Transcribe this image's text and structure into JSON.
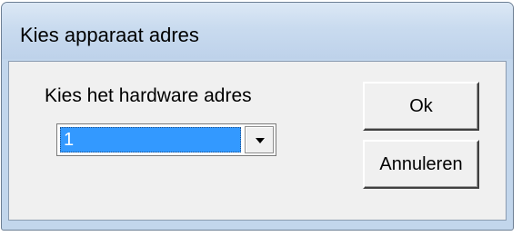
{
  "window": {
    "title": "Kies apparaat adres"
  },
  "dialog": {
    "prompt_label": "Kies het hardware adres",
    "address_select": {
      "selected_value": "1"
    },
    "ok_label": "Ok",
    "cancel_label": "Annuleren"
  },
  "icons": {
    "dropdown": "chevron-down-icon"
  },
  "colors": {
    "selection_highlight": "#3399ff",
    "title_bar": "#c9dbef",
    "dialog_background": "#f0f0f0"
  }
}
